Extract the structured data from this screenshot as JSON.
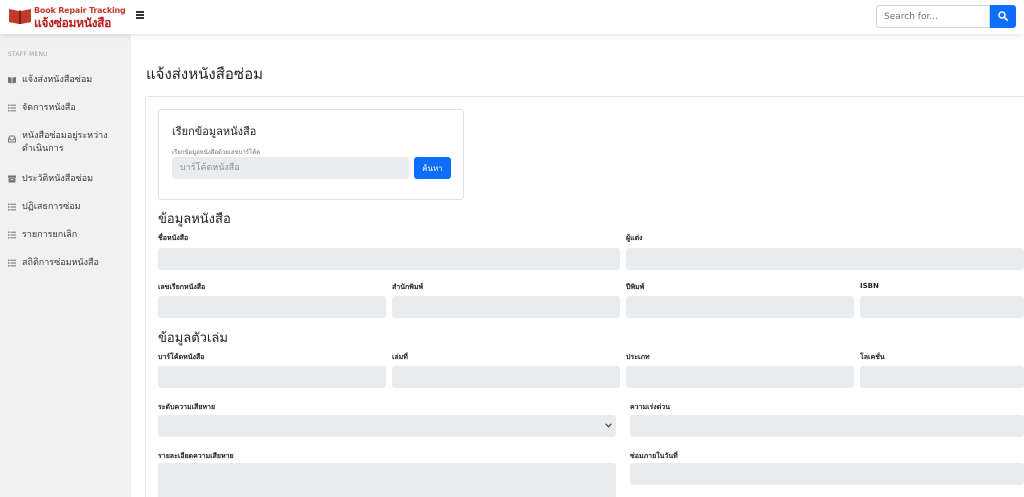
{
  "topbar": {
    "brand_en": "Book Repair Tracking",
    "brand_th": "แจ้งซ่อมหนังสือ",
    "search_placeholder": "Search for...",
    "icons": {
      "menu": "hamburger-icon",
      "search": "search-icon",
      "logo": "book-logo"
    }
  },
  "sidebar": {
    "heading": "STAFF MENU",
    "items": [
      {
        "label": "แจ้งส่งหนังสือซ่อม",
        "icon": "book-icon"
      },
      {
        "label": "จัดการหนังสือ",
        "icon": "list-icon"
      },
      {
        "label": "หนังสือซ่อมอยู่ระหว่างดำเนินการ",
        "icon": "inbox-icon"
      },
      {
        "label": "ประวัติหนังสือซ่อม",
        "icon": "archive-icon"
      },
      {
        "label": "ปฏิเสธการซ่อม",
        "icon": "list-icon"
      },
      {
        "label": "รายการยกเลิก",
        "icon": "list-icon"
      },
      {
        "label": "สถิติการซ่อมหนังสือ",
        "icon": "list-icon"
      }
    ]
  },
  "main": {
    "title": "แจ้งส่งหนังสือซ่อม",
    "fetch": {
      "title": "เรียกข้อมูลหนังสือ",
      "hint": "เรียกข้อมูลหนังสือด้วยเลขบาร์โค้ด",
      "placeholder": "บาร์โค้ดหนังสือ",
      "button": "ค้นหา"
    },
    "book_info": {
      "title": "ข้อมูลหนังสือ",
      "labels": {
        "book_name": "ชื่อหนังสือ",
        "author": "ผู้แต่ง",
        "call_number": "เลขเรียกหนังสือ",
        "publisher": "สำนักพิมพ์",
        "year": "ปีพิมพ์",
        "isbn": "ISBN"
      }
    },
    "item_info": {
      "title": "ข้อมูลตัวเล่ม",
      "labels": {
        "barcode": "บาร์โค้ดหนังสือ",
        "volume": "เล่มที่",
        "type": "ประเภท",
        "location": "โลเคชั่น",
        "damage_level": "ระดับความเสียหาย",
        "urgency": "ความเร่งด่วน",
        "damage_detail": "รายละเอียดความเสียหาย",
        "repair_within": "ซ่อมภายในวันที่"
      }
    }
  },
  "colors": {
    "primary": "#0d6efd",
    "brand_red": "#c0392b",
    "sidebar_bg": "#f1f1f1",
    "field_bg": "#e9ecef"
  }
}
